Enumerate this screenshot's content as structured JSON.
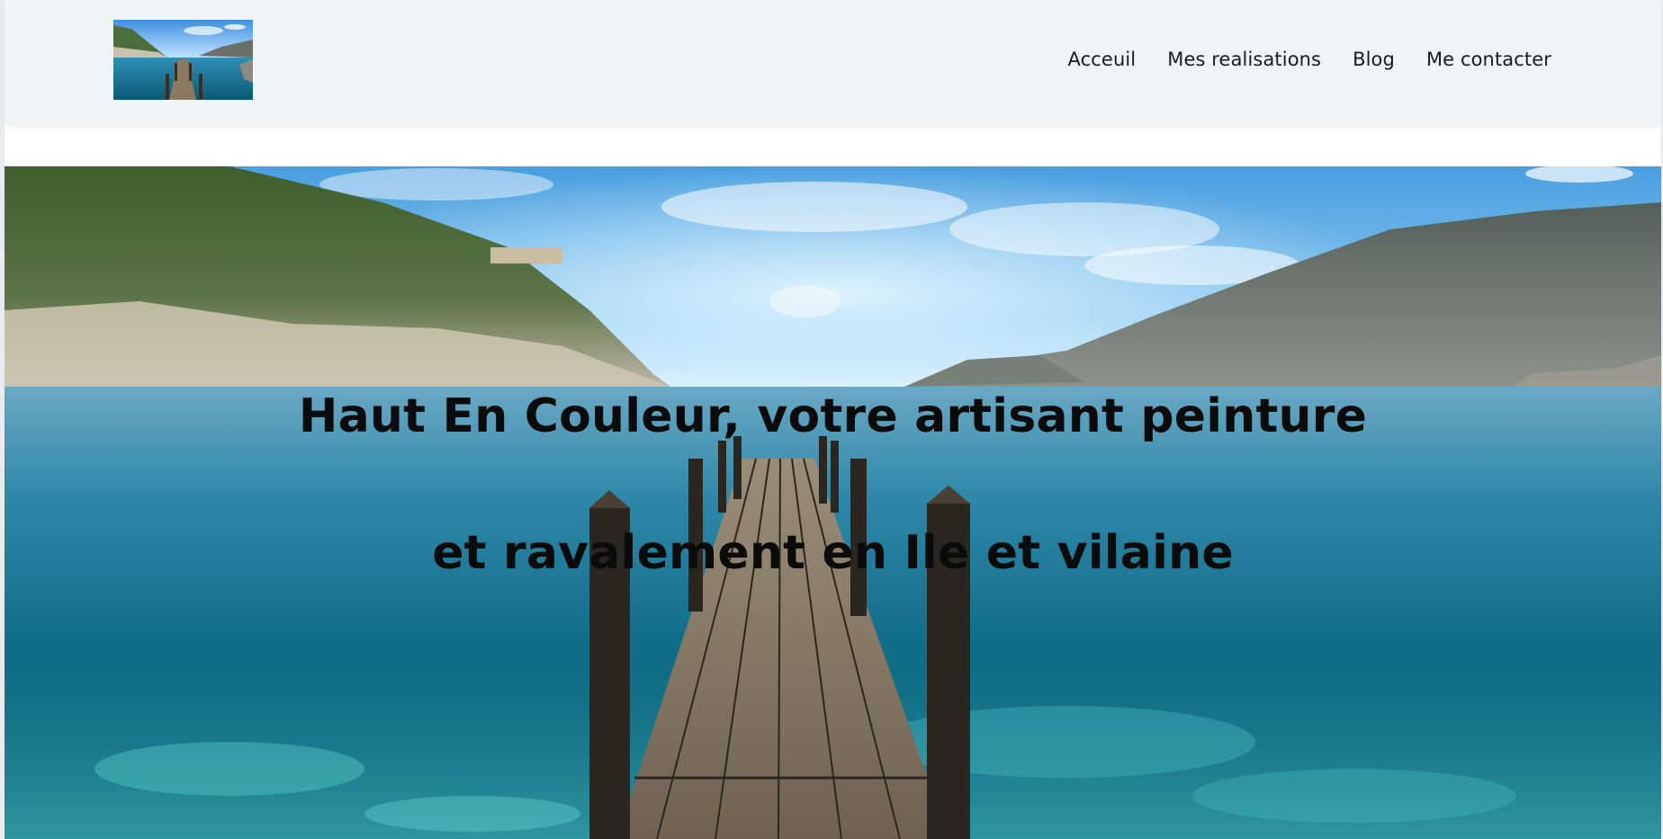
{
  "header": {
    "logo_alt": "Haut En Couleur logo"
  },
  "nav": {
    "items": [
      {
        "label": "Acceuil"
      },
      {
        "label": "Mes realisations"
      },
      {
        "label": "Blog"
      },
      {
        "label": "Me contacter"
      }
    ]
  },
  "hero": {
    "title_line1": "Haut En Couleur, votre artisant peinture",
    "title_line2": "et ravalement en Ile et vilaine"
  },
  "colors": {
    "header_bg": "#f1f4f7",
    "nav_text": "#1a1a1a",
    "hero_text": "#0b0b0b",
    "sky": "#5ab0e8",
    "sea": "#0f6e8c"
  }
}
